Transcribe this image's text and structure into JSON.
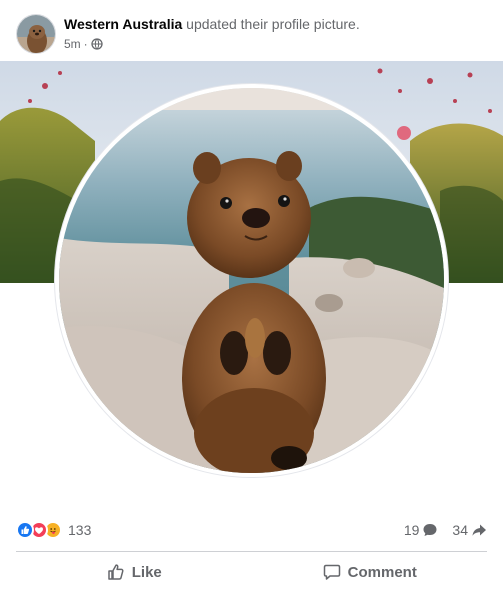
{
  "post": {
    "author": "Western Australia",
    "action_text": "updated their profile picture.",
    "time": "5m",
    "separator": "·",
    "privacy_icon": "globe-icon"
  },
  "reactions": {
    "icons": [
      "like-reaction-icon",
      "love-reaction-icon",
      "care-reaction-icon"
    ],
    "colors": {
      "like": "#1877f2",
      "love": "#f33e58",
      "care": "#f7b125"
    },
    "count": "133",
    "comments_count": "19",
    "shares_count": "34"
  },
  "actions": {
    "like_label": "Like",
    "comment_label": "Comment"
  },
  "theme": {
    "muted_text": "#65676b",
    "divider": "#ced0d4"
  }
}
